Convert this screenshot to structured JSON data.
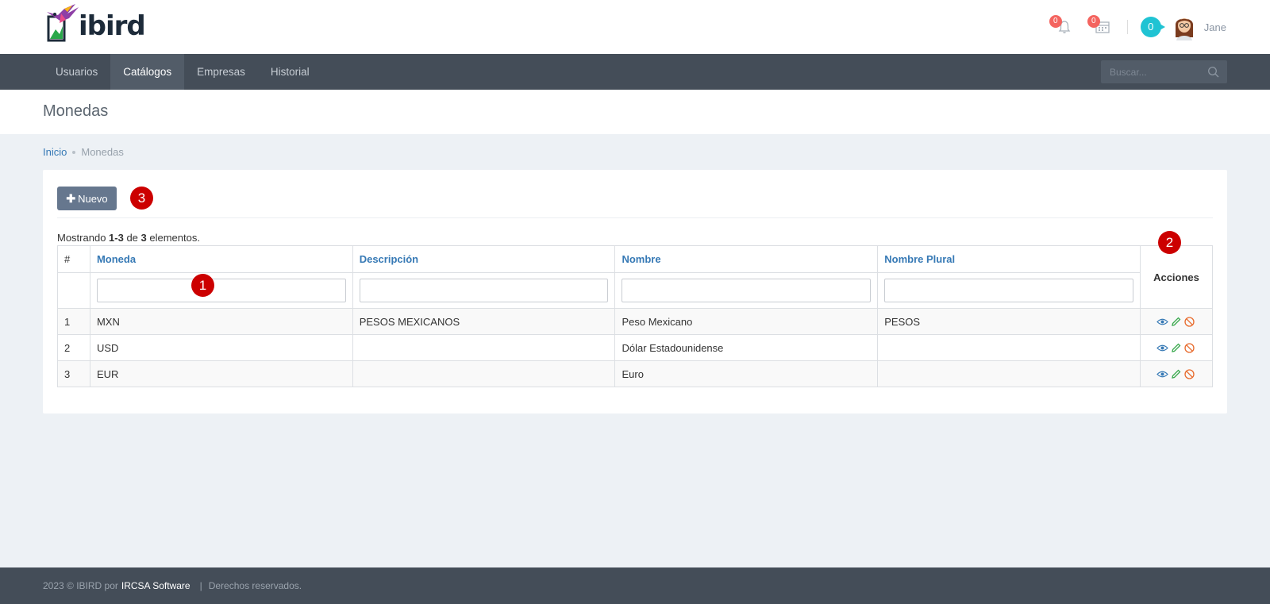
{
  "header": {
    "logo_text": "ibird",
    "notifications_count": "0",
    "calendar_count": "0",
    "chat_count": "0",
    "user_name": "Jane"
  },
  "nav": {
    "items": [
      {
        "label": "Usuarios",
        "active": false
      },
      {
        "label": "Catálogos",
        "active": true
      },
      {
        "label": "Empresas",
        "active": false
      },
      {
        "label": "Historial",
        "active": false
      }
    ],
    "search_placeholder": "Buscar..."
  },
  "page": {
    "title": "Monedas"
  },
  "breadcrumb": {
    "home": "Inicio",
    "current": "Monedas"
  },
  "toolbar": {
    "new_label": "Nuevo"
  },
  "markers": {
    "m1": "1",
    "m2": "2",
    "m3": "3"
  },
  "summary": {
    "prefix": "Mostrando ",
    "range": "1-3",
    "mid": " de ",
    "total": "3",
    "suffix": " elementos."
  },
  "table": {
    "headers": {
      "num": "#",
      "moneda": "Moneda",
      "descripcion": "Descripción",
      "nombre": "Nombre",
      "nombre_plural": "Nombre Plural",
      "acciones": "Acciones"
    },
    "rows": [
      {
        "num": "1",
        "moneda": "MXN",
        "descripcion": "PESOS MEXICANOS",
        "nombre": "Peso Mexicano",
        "nombre_plural": "PESOS"
      },
      {
        "num": "2",
        "moneda": "USD",
        "descripcion": "",
        "nombre": "Dólar Estadounidense",
        "nombre_plural": ""
      },
      {
        "num": "3",
        "moneda": "EUR",
        "descripcion": "",
        "nombre": "Euro",
        "nombre_plural": ""
      }
    ]
  },
  "footer": {
    "copyright": "2023 © IBIRD por",
    "company": "IRCSA Software",
    "separator": "|",
    "rights": "Derechos reservados."
  },
  "colors": {
    "nav_bg": "#444d58",
    "accent_link": "#3679b5",
    "button_bg": "#66778e",
    "marker_red": "#cc0000",
    "badge_red": "#f4645f",
    "chat_cyan": "#20c3d3"
  },
  "icons": [
    "bell-icon",
    "calendar-icon",
    "search-icon",
    "plus-icon",
    "eye-icon",
    "pencil-icon",
    "ban-icon"
  ]
}
